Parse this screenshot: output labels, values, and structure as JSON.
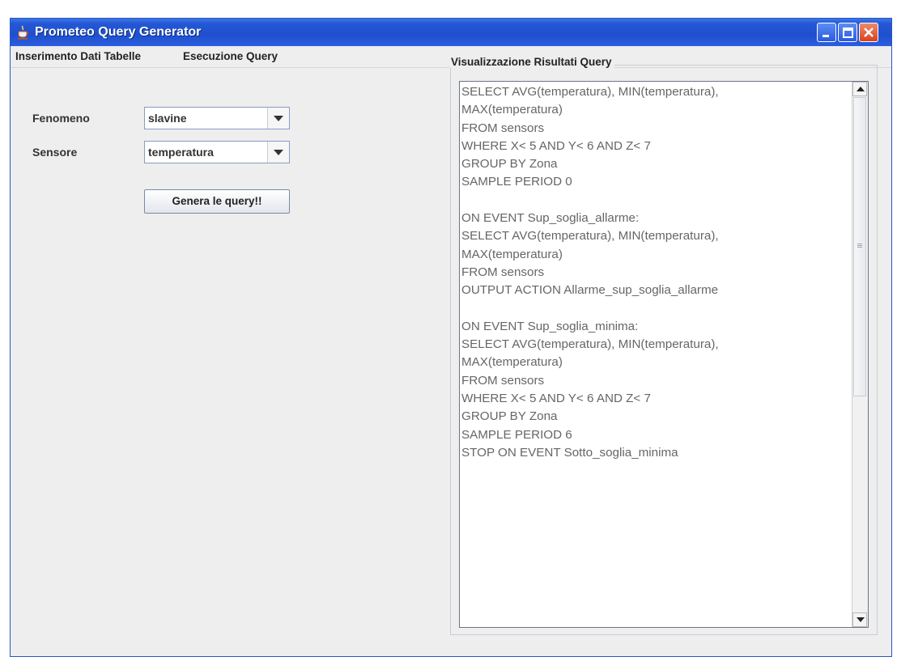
{
  "window": {
    "title": "Prometeo Query Generator"
  },
  "menu": {
    "items": [
      "Inserimento Dati Tabelle",
      "Esecuzione Query"
    ]
  },
  "form": {
    "fenomeno_label": "Fenomeno",
    "fenomeno_value": "slavine",
    "sensore_label": "Sensore",
    "sensore_value": "temperatura",
    "generate_button": "Genera le query!!"
  },
  "results": {
    "group_title": "Visualizzazione Risultati Query",
    "text": "SELECT AVG(temperatura), MIN(temperatura),\nMAX(temperatura)\nFROM sensors\nWHERE X< 5 AND Y< 6 AND Z< 7\nGROUP BY Zona\nSAMPLE PERIOD 0\n\nON EVENT Sup_soglia_allarme:\nSELECT AVG(temperatura), MIN(temperatura),\nMAX(temperatura)\nFROM sensors\nOUTPUT ACTION Allarme_sup_soglia_allarme\n\nON EVENT Sup_soglia_minima:\nSELECT AVG(temperatura), MIN(temperatura),\nMAX(temperatura)\nFROM sensors\nWHERE X< 5 AND Y< 6 AND Z< 7\nGROUP BY Zona\nSAMPLE PERIOD 6\nSTOP ON EVENT Sotto_soglia_minima"
  },
  "icons": {
    "app": "java-cup-icon",
    "minimize": "minimize-icon",
    "maximize": "maximize-icon",
    "close": "close-icon",
    "dropdown": "chevron-down-icon"
  },
  "colors": {
    "titlebar": "#2457d6",
    "close_button": "#d9421c",
    "window_bg": "#eeeeee"
  }
}
